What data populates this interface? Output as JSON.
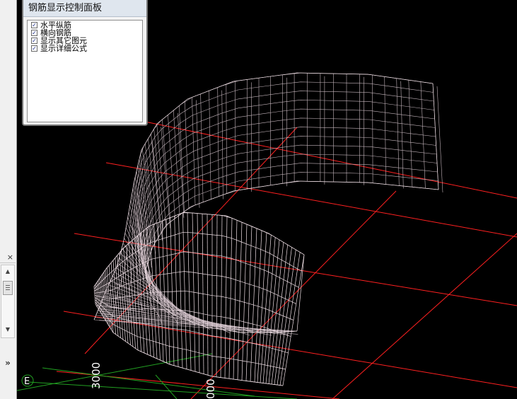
{
  "panel": {
    "title": "钢筋显示控制面板",
    "options": [
      {
        "label": "水平纵筋",
        "checked": true
      },
      {
        "label": "横向钢筋",
        "checked": true
      },
      {
        "label": "显示其它图元",
        "checked": true
      },
      {
        "label": "显示详细公式",
        "checked": true
      }
    ]
  },
  "side": {
    "close_glyph": "×",
    "up_glyph": "▲",
    "down_glyph": "▼",
    "expand_glyph": "»"
  },
  "viewport": {
    "axis_label_vertical": "3000",
    "axis_label_partial": "000",
    "axis_marker": "E",
    "colors": {
      "background": "#000000",
      "grid_red": "#ff2020",
      "grid_green": "#22a022",
      "wire": "#f2e2e8"
    }
  }
}
